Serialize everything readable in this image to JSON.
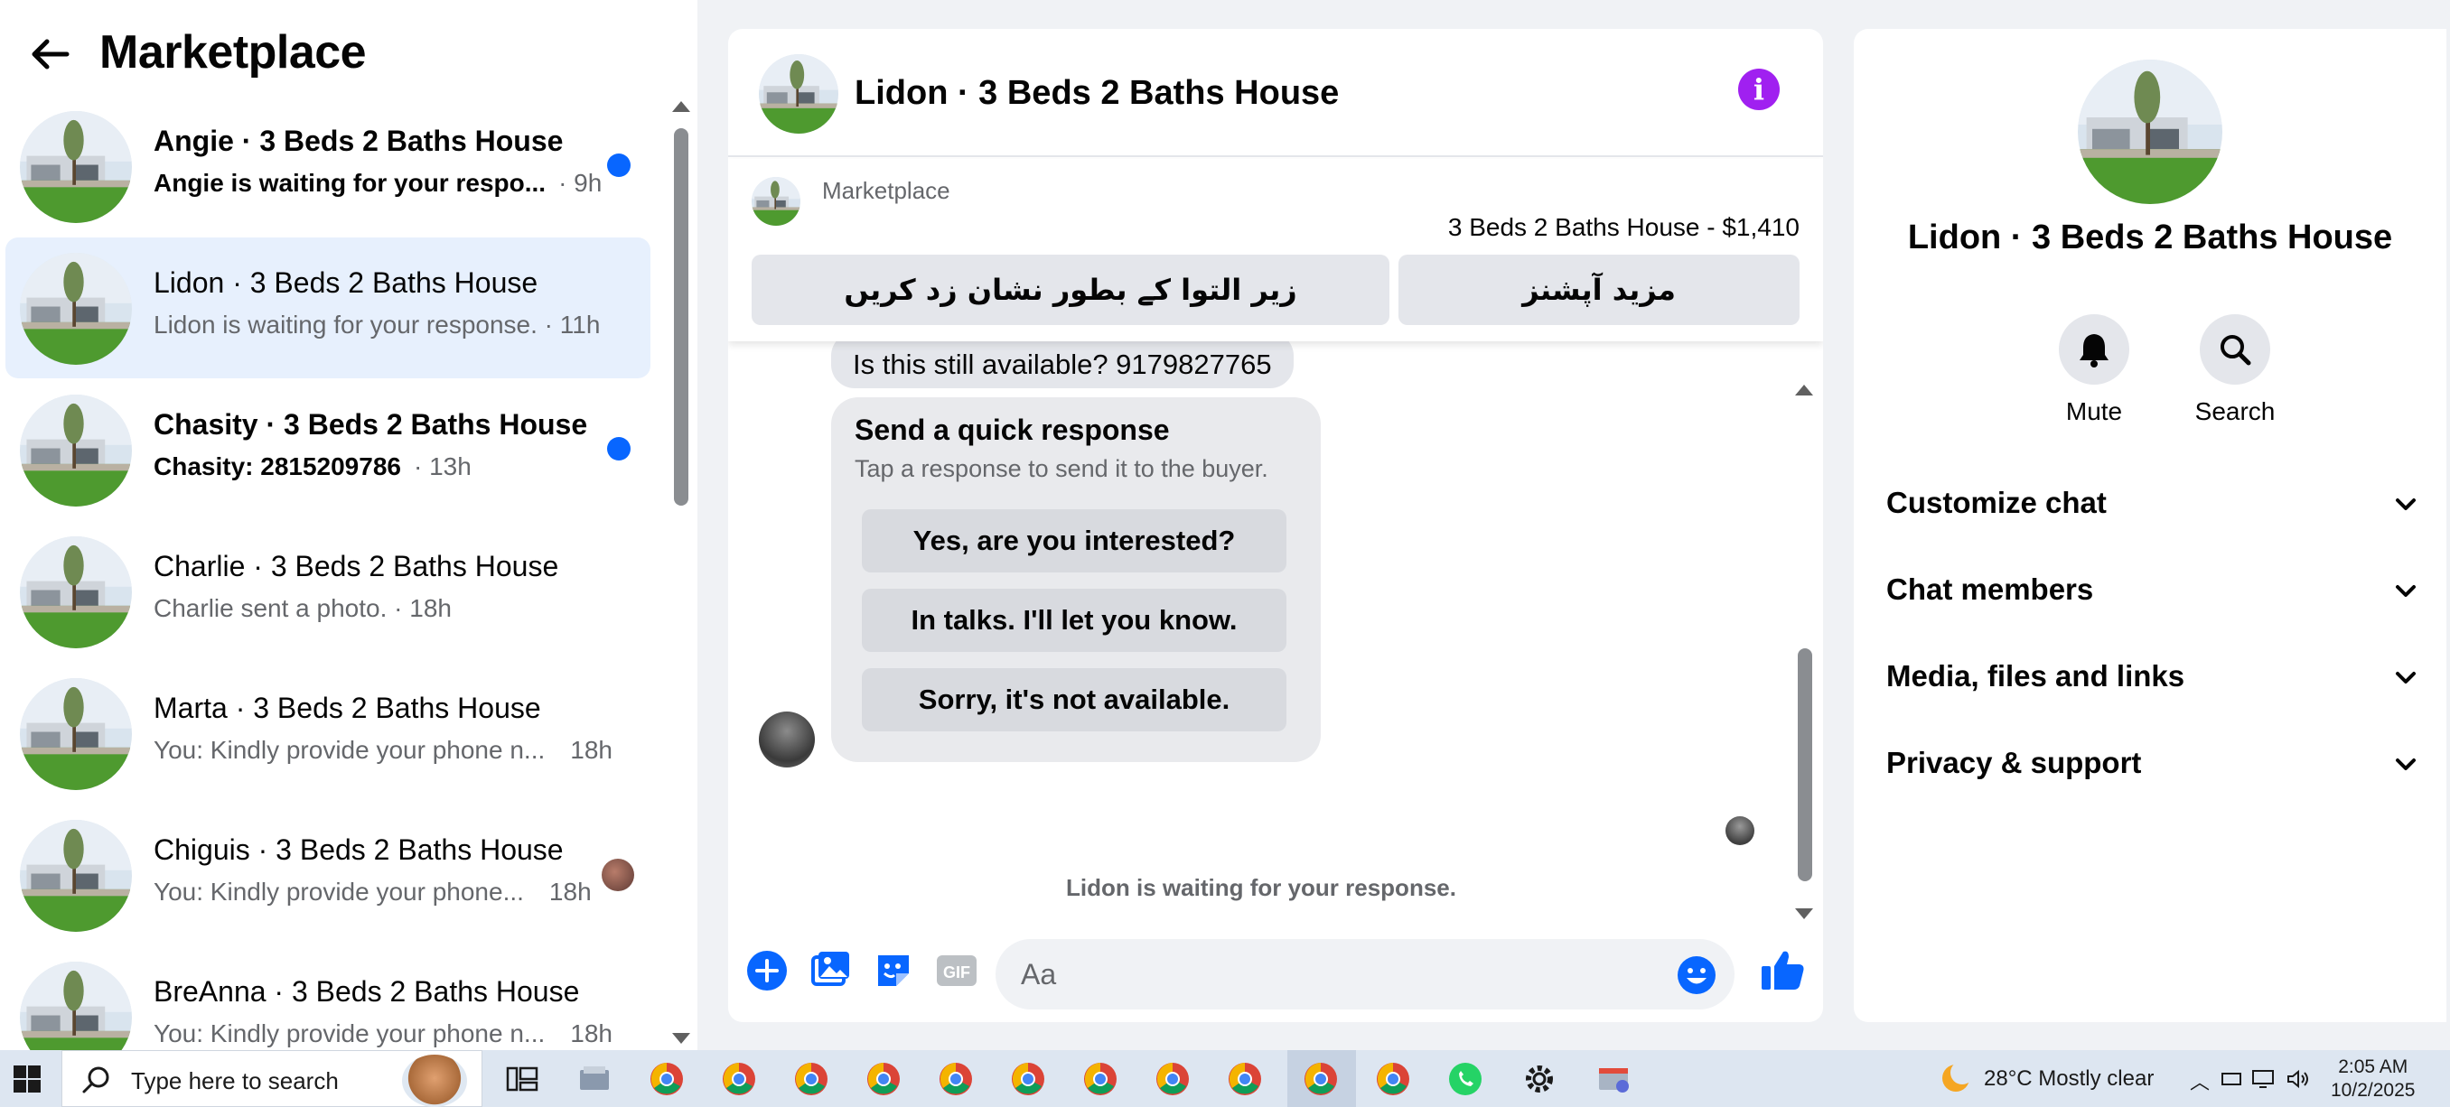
{
  "sidebar": {
    "title": "Marketplace",
    "conversations": [
      {
        "name": "Angie · 3 Beds 2 Baths House",
        "preview": "Angie is waiting for your respo...",
        "time": "· 9h",
        "unread": true,
        "active": false,
        "indicator": "dot"
      },
      {
        "name": "Lidon · 3 Beds 2 Baths House",
        "preview": "Lidon is waiting for your response. · 11h",
        "time": "",
        "unread": false,
        "active": true,
        "indicator": "none"
      },
      {
        "name": "Chasity · 3 Beds 2 Baths House",
        "preview": "Chasity: 2815209786",
        "time": "· 13h",
        "unread": true,
        "active": false,
        "indicator": "dot"
      },
      {
        "name": "Charlie · 3 Beds 2 Baths House",
        "preview": "Charlie sent a photo. · 18h",
        "time": "",
        "unread": false,
        "active": false,
        "indicator": "none"
      },
      {
        "name": "Marta · 3 Beds 2 Baths House",
        "preview": "You: Kindly provide your phone n...",
        "time": "18h",
        "unread": false,
        "active": false,
        "indicator": "none"
      },
      {
        "name": "Chiguis · 3 Beds 2 Baths House",
        "preview": "You: Kindly provide your phone...",
        "time": "18h",
        "unread": false,
        "active": false,
        "indicator": "avatar"
      },
      {
        "name": "BreAnna · 3 Beds 2 Baths House",
        "preview": "You: Kindly provide your phone n...",
        "time": "18h",
        "unread": false,
        "active": false,
        "indicator": "none"
      }
    ]
  },
  "chat": {
    "title": "Lidon · 3 Beds 2 Baths House",
    "listing": {
      "source": "Marketplace",
      "price_line": "3 Beds 2 Baths House - $1,410",
      "mark_pending": "زیر التوا کے بطور نشان زد کریں",
      "more_options": "مزید آپشنز"
    },
    "messages": {
      "top_bubble": "Is this still available? 9179827765",
      "quick_title": "Send a quick response",
      "quick_subtitle": "Tap a response to send it to the buyer.",
      "quick_replies": [
        "Yes, are you interested?",
        "In talks. I'll let you know.",
        "Sorry, it's not available."
      ],
      "waiting": "Lidon is waiting for your response."
    },
    "composer": {
      "placeholder": "Aa",
      "gif_label": "GIF"
    }
  },
  "details": {
    "title": "Lidon · 3 Beds 2 Baths House",
    "actions": [
      {
        "label": "Mute",
        "icon": "bell-icon"
      },
      {
        "label": "Search",
        "icon": "search-icon"
      }
    ],
    "sections": [
      "Customize chat",
      "Chat members",
      "Media, files and links",
      "Privacy & support"
    ]
  },
  "taskbar": {
    "search_placeholder": "Type here to search",
    "weather": "28°C  Mostly clear",
    "time": "2:05 AM",
    "date": "10/2/2025"
  },
  "colors": {
    "accent": "#0866ff",
    "unread_dot": "#0866ff",
    "active_row": "#e7f0fd",
    "info_purple": "#a020f0"
  }
}
